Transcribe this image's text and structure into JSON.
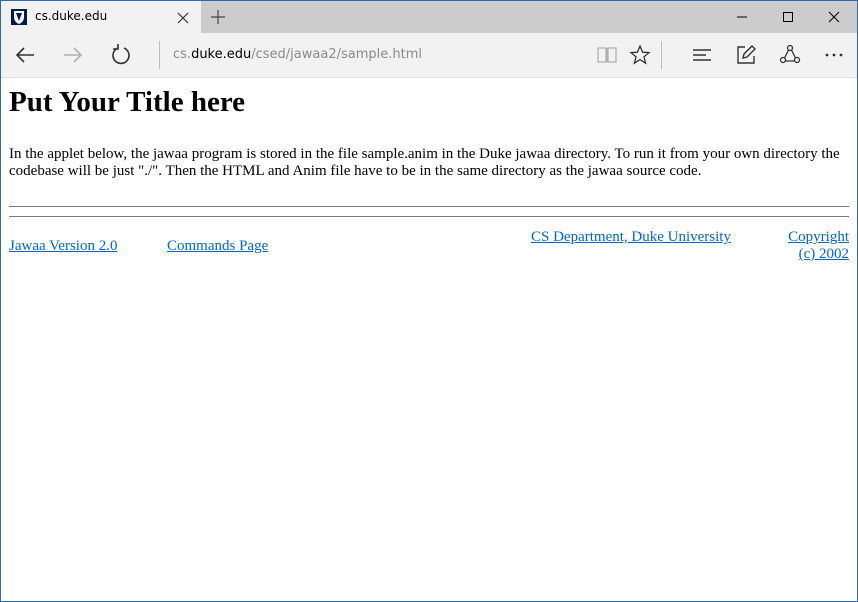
{
  "browser": {
    "tab": {
      "title": "cs.duke.edu",
      "favicon": "duke-shield-icon"
    },
    "address": {
      "prefix": "cs.",
      "host": "duke.edu",
      "path": "/csed/jawaa2/sample.html"
    },
    "icons": {
      "back": "back-arrow-icon",
      "forward": "forward-arrow-icon",
      "refresh": "refresh-icon",
      "reading_view": "book-icon",
      "favorites": "star-icon",
      "hub": "hub-icon",
      "web_note": "pen-note-icon",
      "share": "share-icon",
      "more": "ellipsis-icon"
    },
    "accent_color": "#2b6cb0"
  },
  "page": {
    "heading": "Put Your Title here",
    "intro": "In the applet below, the jawaa program is stored in the file sample.anim in the Duke jawaa directory. To run it from your own directory the codebase will be just \"./\". Then the HTML and Anim file have to be in the same directory as the jawaa source code.",
    "footer": {
      "jawaa_version": "Jawaa Version 2.0",
      "commands_page": "Commands Page",
      "cs_department": "CS Department, Duke University",
      "copyright": "Copyright (c) 2002"
    },
    "link_color": "#0066cc"
  }
}
